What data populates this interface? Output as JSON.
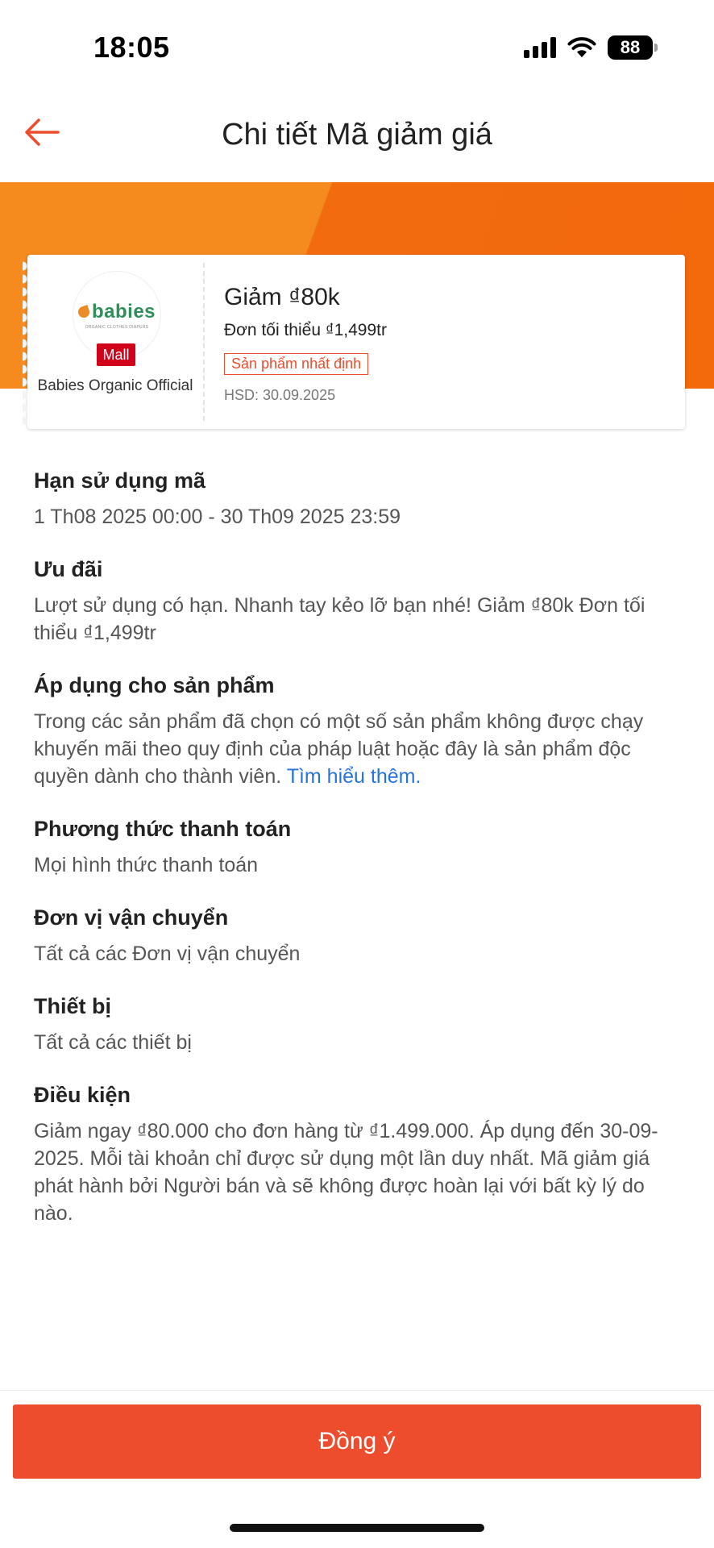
{
  "status": {
    "time": "18:05",
    "battery": "88"
  },
  "header": {
    "title": "Chi tiết Mã giảm giá"
  },
  "voucher": {
    "logo_text": "babies",
    "logo_tagline": "ORGANIC CLOTHES DIAPERS",
    "mall_badge": "Mall",
    "shop_name": "Babies Organic Official",
    "title": "Giảm ₫80k",
    "min_order": "Đơn tối thiểu ₫1,499tr",
    "tag": "Sản phẩm nhất định",
    "expiry": "HSD: 30.09.2025"
  },
  "sections": {
    "validity": {
      "title": "Hạn sử dụng mã",
      "text": "1 Th08 2025 00:00 - 30 Th09 2025 23:59"
    },
    "offer": {
      "title": "Ưu đãi",
      "text": "Lượt sử dụng có hạn. Nhanh tay kẻo lỡ bạn nhé! Giảm ₫80k Đơn tối thiểu ₫1,499tr"
    },
    "products": {
      "title": "Áp dụng cho sản phẩm",
      "text": "Trong các sản phẩm đã chọn có một số sản phẩm không được chạy khuyến mãi theo quy định của pháp luật hoặc đây là sản phẩm độc quyền dành cho thành viên. ",
      "link": "Tìm hiểu thêm."
    },
    "payment": {
      "title": "Phương thức thanh toán",
      "text": "Mọi hình thức thanh toán"
    },
    "shipping": {
      "title": "Đơn vị vận chuyển",
      "text": "Tất cả các Đơn vị vận chuyển"
    },
    "device": {
      "title": "Thiết bị",
      "text": "Tất cả các thiết bị"
    },
    "conditions": {
      "title": "Điều kiện",
      "text": "Giảm ngay ₫80.000 cho đơn hàng từ ₫1.499.000. Áp dụng đến 30-09-2025. Mỗi tài khoản chỉ được sử dụng một lần duy nhất. Mã giảm giá phát hành bởi Người bán và sẽ không được hoàn lại với bất kỳ lý do nào."
    }
  },
  "footer": {
    "agree_label": "Đồng ý"
  },
  "icons": {
    "back": "arrow-left-icon",
    "signal": "cellular-signal-icon",
    "wifi": "wifi-icon",
    "battery": "battery-icon"
  },
  "colors": {
    "accent": "#ee4d2d",
    "banner_light": "#f58a1f",
    "banner_dark": "#f26a0c",
    "mall_red": "#d0011b",
    "link": "#2673dd"
  }
}
